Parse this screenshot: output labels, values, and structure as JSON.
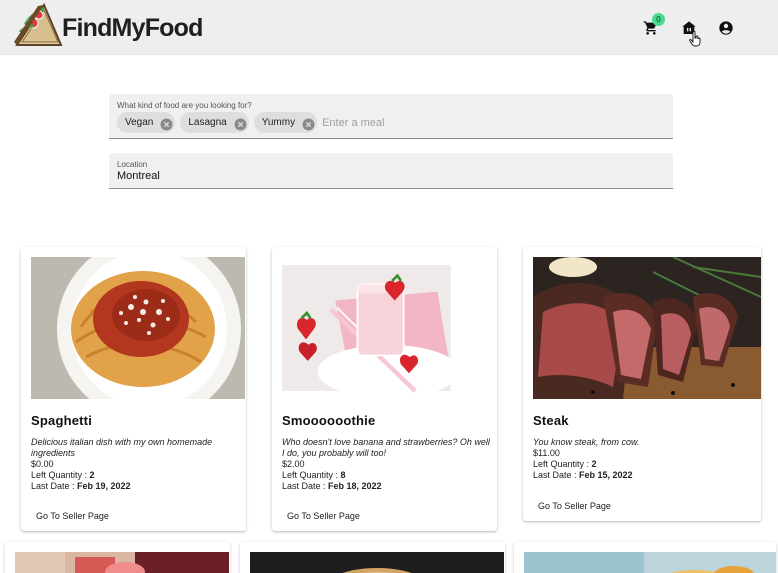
{
  "header": {
    "brand": "FindMyFood",
    "cart_count": "0"
  },
  "search": {
    "food_label": "What kind of food are you looking for?",
    "chips": [
      "Vegan",
      "Lasagna",
      "Yummy"
    ],
    "food_placeholder": "Enter a meal",
    "location_label": "Location",
    "location_value": "Montreal"
  },
  "cards": [
    {
      "title": "Spaghetti",
      "description": "Delicious italian dish with my own homemade ingredients",
      "price": "$0.00",
      "qty_label": "Left Quantity : ",
      "qty": "2",
      "date_label": "Last Date : ",
      "date": "Feb 19, 2022",
      "link": "Go To Seller Page"
    },
    {
      "title": "Smoooooothie",
      "description": "Who doesn't love banana and strawberries? Oh well I do, you probably will too!",
      "price": "$2.00",
      "qty_label": "Left Quantity : ",
      "qty": "8",
      "date_label": "Last Date : ",
      "date": "Feb 18, 2022",
      "link": "Go To Seller Page"
    },
    {
      "title": "Steak",
      "description": "You know steak, from cow.",
      "price": "$11.00",
      "qty_label": "Left Quantity : ",
      "qty": "2",
      "date_label": "Last Date : ",
      "date": "Feb 15, 2022",
      "link": "Go To Seller Page"
    }
  ],
  "icons": {
    "logo": "sandwich-logo-icon",
    "cart": "shopping-cart-icon",
    "home": "store-icon",
    "account": "account-circle-icon",
    "chip_delete": "cancel-circle-icon"
  },
  "colors": {
    "header_bg": "#eeeeee",
    "badge": "#4ad991",
    "field_bg": "#f0f0f0"
  }
}
